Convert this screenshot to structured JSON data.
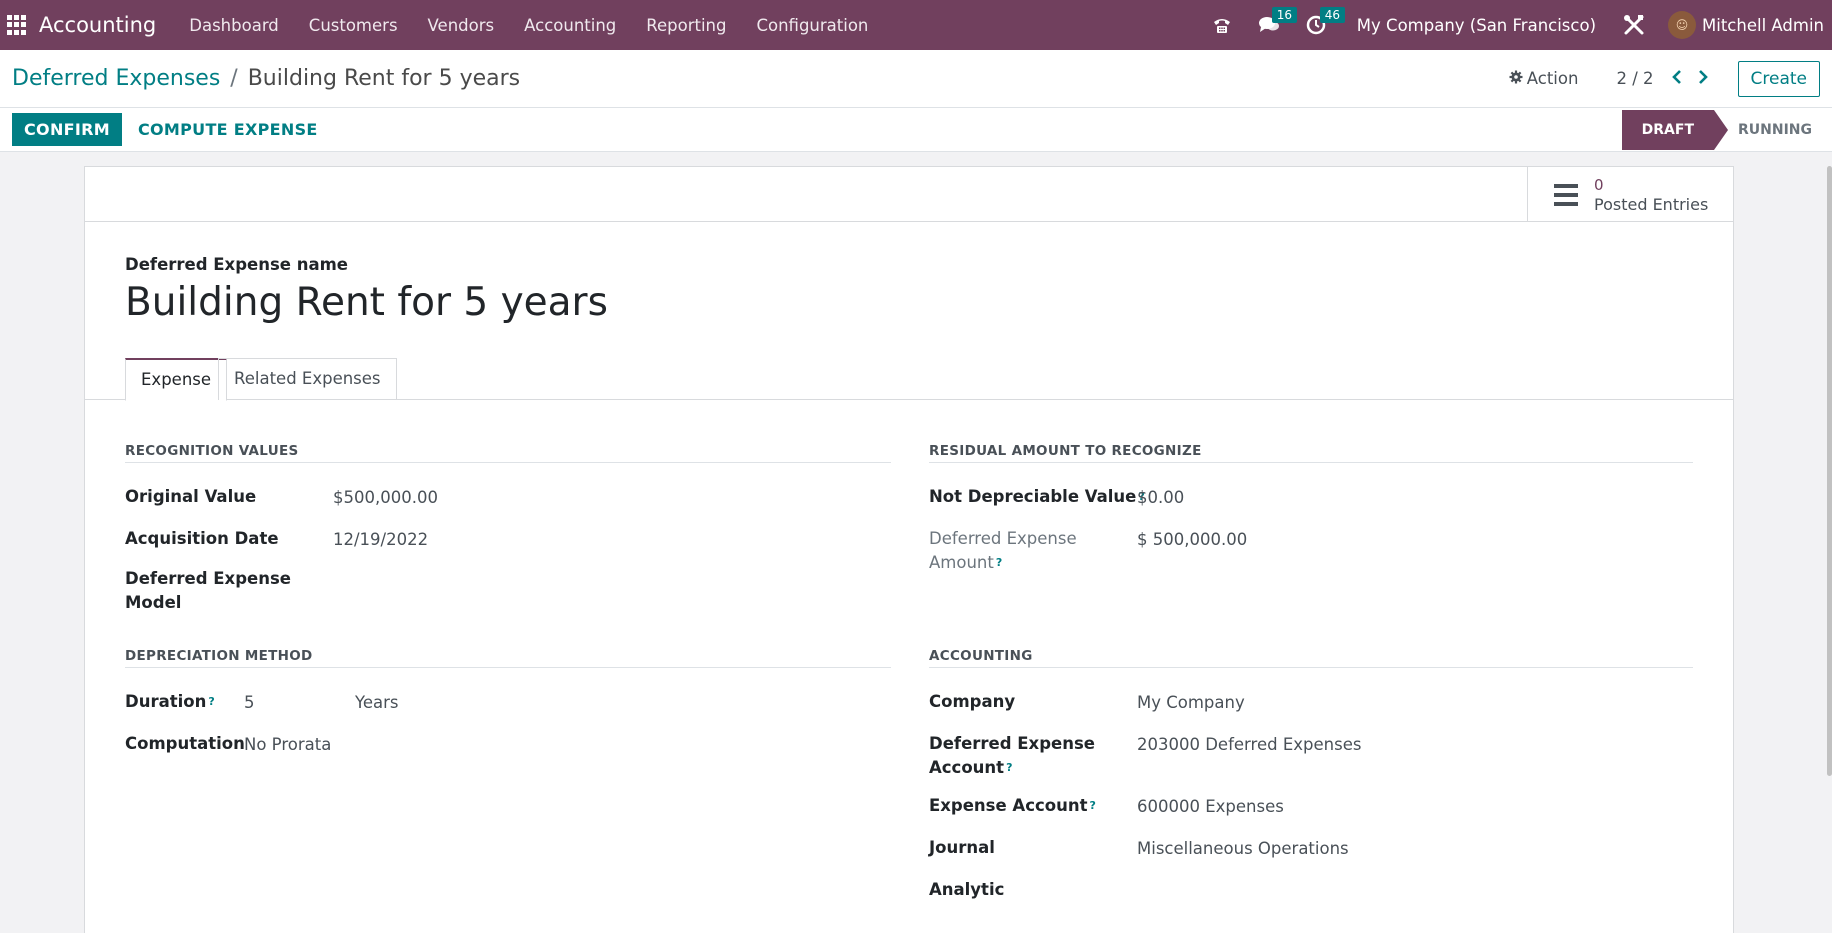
{
  "topnav": {
    "app_name": "Accounting",
    "menu": [
      "Dashboard",
      "Customers",
      "Vendors",
      "Accounting",
      "Reporting",
      "Configuration"
    ],
    "messages_count": "16",
    "activities_count": "46",
    "company": "My Company (San Francisco)",
    "user": "Mitchell Admin"
  },
  "breadcrumb": {
    "parent": "Deferred Expenses",
    "separator": "/",
    "current": "Building Rent for 5 years"
  },
  "control": {
    "action_label": "Action",
    "pager": "2 / 2",
    "create_label": "Create"
  },
  "statusbar": {
    "confirm_label": "CONFIRM",
    "compute_label": "COMPUTE EXPENSE",
    "stages": [
      "DRAFT",
      "RUNNING"
    ],
    "active_stage": "DRAFT"
  },
  "smart_button": {
    "value": "0",
    "label": "Posted Entries"
  },
  "form": {
    "name_label": "Deferred Expense name",
    "name": "Building Rent for 5 years",
    "tabs": [
      "Expense",
      "Related Expenses"
    ],
    "recognition": {
      "title": "RECOGNITION VALUES",
      "original_value_label": "Original Value",
      "original_value": "$500,000.00",
      "acquisition_date_label": "Acquisition Date",
      "acquisition_date": "12/19/2022",
      "model_label_1": "Deferred Expense",
      "model_label_2": "Model"
    },
    "residual": {
      "title": "RESIDUAL AMOUNT TO RECOGNIZE",
      "not_depreciable_label": "Not Depreciable Value",
      "not_depreciable_value": "$0.00",
      "deferred_amount_label_1": "Deferred Expense",
      "deferred_amount_label_2": "Amount",
      "deferred_amount_value": "$ 500,000.00"
    },
    "depreciation": {
      "title": "DEPRECIATION METHOD",
      "duration_label": "Duration",
      "duration_value": "5",
      "duration_unit": "Years",
      "computation_label": "Computation",
      "computation_value": "No Prorata"
    },
    "accounting": {
      "title": "ACCOUNTING",
      "company_label": "Company",
      "company_value": "My Company",
      "deferred_account_label_1": "Deferred Expense",
      "deferred_account_label_2": "Account",
      "deferred_account_value": "203000 Deferred Expenses",
      "expense_account_label": "Expense Account",
      "expense_account_value": "600000 Expenses",
      "journal_label": "Journal",
      "journal_value": "Miscellaneous Operations",
      "analytic_label": "Analytic"
    },
    "help_mark": "?"
  },
  "colors": {
    "brand": "#71405e",
    "accent": "#017e84"
  }
}
